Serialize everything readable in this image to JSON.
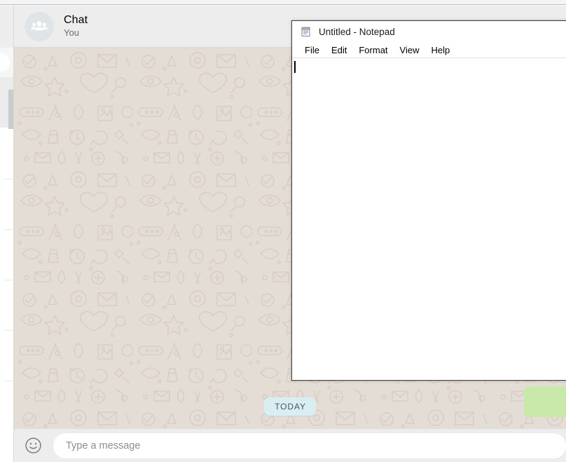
{
  "chat": {
    "header": {
      "title": "Chat",
      "subtitle": "You",
      "avatar_icon": "group-avatar-icon"
    },
    "body": {
      "date_divider": "TODAY"
    },
    "footer": {
      "emoji_icon": "smiley-icon",
      "input_value": "",
      "input_placeholder": "Type a message"
    }
  },
  "notepad": {
    "icon": "notepad-icon",
    "title": "Untitled - Notepad",
    "menu": [
      {
        "label": "File"
      },
      {
        "label": "Edit"
      },
      {
        "label": "Format"
      },
      {
        "label": "View"
      },
      {
        "label": "Help"
      }
    ],
    "document_text": ""
  },
  "colors": {
    "chat_header_bg": "#ededed",
    "chat_body_bg": "#e4ddd6",
    "outgoing_bubble": "#c9e9ab",
    "date_pill_bg": "#d9eef3",
    "avatar_bg": "#dfe5e7",
    "notepad_border": "#3c3c3c"
  }
}
